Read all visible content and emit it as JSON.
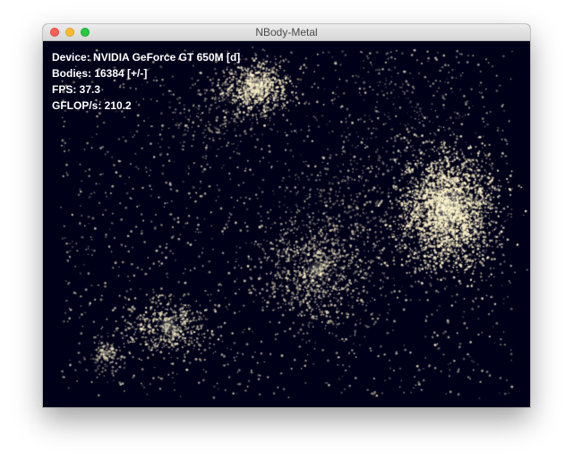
{
  "window": {
    "title": "NBody-Metal"
  },
  "hud": {
    "device": "Device: NVIDIA GeForce GT 650M [d]",
    "bodies": "Bodies: 16384 [+/-]",
    "fps": "FPS: 37.3",
    "gflops": "GFLOP/s: 210.2"
  },
  "colors": {
    "background": "#000019",
    "particle": "#fff4c8"
  }
}
